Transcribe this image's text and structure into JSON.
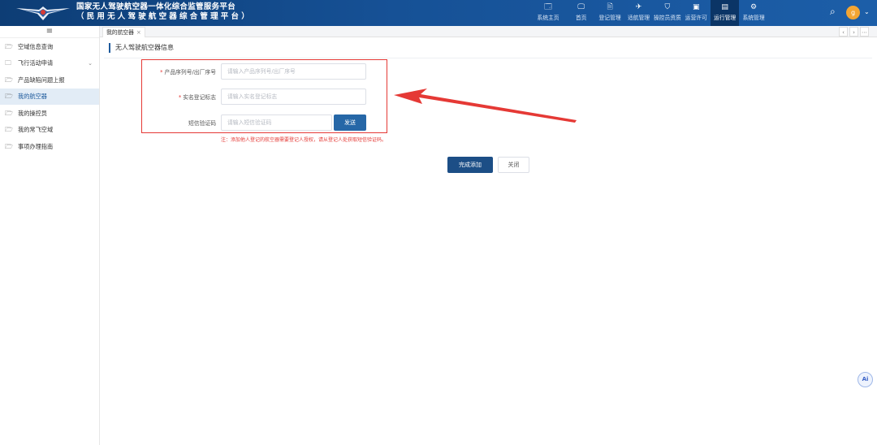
{
  "header": {
    "title_line1": "国家无人驾驶航空器一体化综合监管服务平台",
    "title_line2": "（民用无人驾驶航空器综合管理平台）",
    "nav": [
      {
        "label": "系统主页",
        "icon": "🗔"
      },
      {
        "label": "首页",
        "icon": "🖵"
      },
      {
        "label": "登记管理",
        "icon": "🗎"
      },
      {
        "label": "适航管理",
        "icon": "✈"
      },
      {
        "label": "操控员资质",
        "icon": "⛉"
      },
      {
        "label": "运营许可",
        "icon": "▣"
      },
      {
        "label": "运行管理",
        "icon": "▤"
      },
      {
        "label": "系统管理",
        "icon": "⚙"
      }
    ],
    "active_nav": "运行管理",
    "avatar_text": "g",
    "brand_color": "#165196"
  },
  "sidebar": {
    "toggle_icon": "≡",
    "items": [
      {
        "label": "空域信息查询",
        "icon": "🗁"
      },
      {
        "label": "飞行活动申请",
        "icon": "🗀",
        "has_children": true
      },
      {
        "label": "产品缺陷问题上报",
        "icon": "🗁"
      },
      {
        "label": "我的航空器",
        "icon": "🗁",
        "active": true
      },
      {
        "label": "我的操控员",
        "icon": "🗁"
      },
      {
        "label": "我的常飞空域",
        "icon": "🗁"
      },
      {
        "label": "事项办理指南",
        "icon": "🗁"
      }
    ]
  },
  "tabs": [
    {
      "label": "我的航空器",
      "close": "×"
    }
  ],
  "tab_controls": {
    "prev": "‹",
    "next": "›",
    "more": "⋯"
  },
  "section_title": "无人驾驶航空器信息",
  "form": {
    "serial": {
      "label": "产品序列号/出厂序号",
      "required": true,
      "placeholder": "请输入产品序列号/出厂序号",
      "value": ""
    },
    "realname": {
      "label": "实名登记标志",
      "required": true,
      "placeholder": "请输入实名登记标志",
      "value": ""
    },
    "sms": {
      "label": "短信验证码",
      "required": false,
      "placeholder": "请输入短信验证码",
      "value": ""
    },
    "send_label": "发送",
    "note": "注：添加他人登记的航空器需要登记人授权，请从登记人处获取短信验证码。",
    "required_mark": "*"
  },
  "actions": {
    "submit_label": "完成添加",
    "close_label": "关闭"
  },
  "ai_label": "Ai",
  "annotation_color": "#e53935"
}
